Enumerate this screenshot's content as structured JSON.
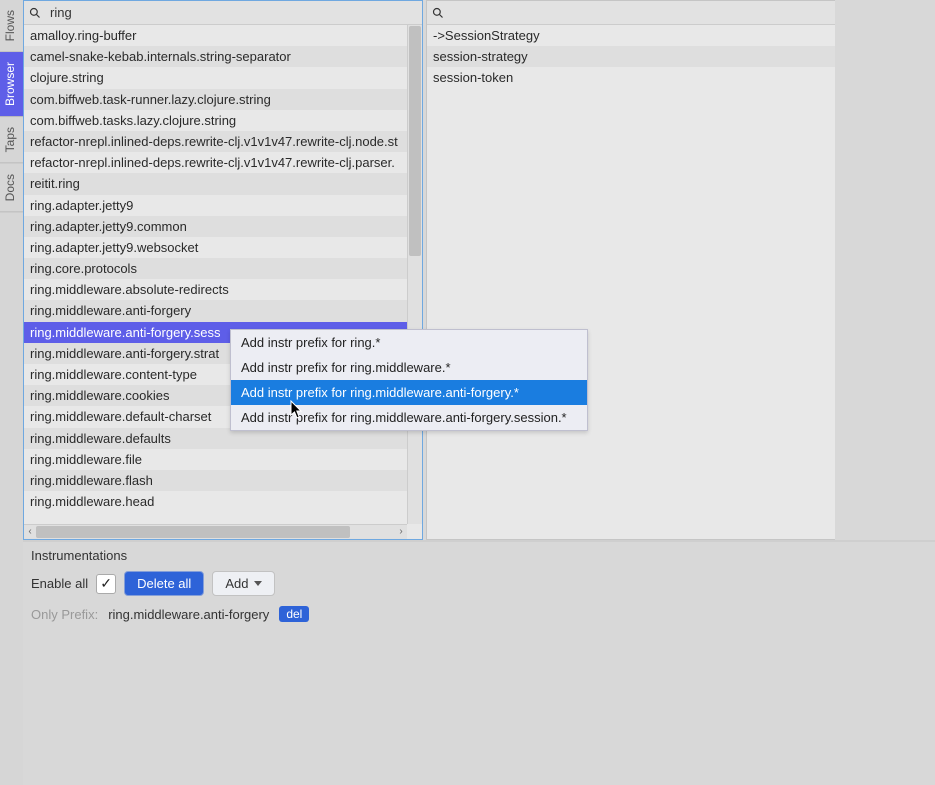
{
  "side_tabs": [
    {
      "id": "flows",
      "label": "Flows",
      "active": false
    },
    {
      "id": "browser",
      "label": "Browser",
      "active": true
    },
    {
      "id": "taps",
      "label": "Taps",
      "active": false
    },
    {
      "id": "docs",
      "label": "Docs",
      "active": false
    }
  ],
  "left_panel": {
    "search_value": "ring",
    "selected_index": 14,
    "items": [
      "amalloy.ring-buffer",
      "camel-snake-kebab.internals.string-separator",
      "clojure.string",
      "com.biffweb.task-runner.lazy.clojure.string",
      "com.biffweb.tasks.lazy.clojure.string",
      "refactor-nrepl.inlined-deps.rewrite-clj.v1v1v47.rewrite-clj.node.st",
      "refactor-nrepl.inlined-deps.rewrite-clj.v1v1v47.rewrite-clj.parser.",
      "reitit.ring",
      "ring.adapter.jetty9",
      "ring.adapter.jetty9.common",
      "ring.adapter.jetty9.websocket",
      "ring.core.protocols",
      "ring.middleware.absolute-redirects",
      "ring.middleware.anti-forgery",
      "ring.middleware.anti-forgery.sess",
      "ring.middleware.anti-forgery.strat",
      "ring.middleware.content-type",
      "ring.middleware.cookies",
      "ring.middleware.default-charset",
      "ring.middleware.defaults",
      "ring.middleware.file",
      "ring.middleware.flash",
      "ring.middleware.head"
    ]
  },
  "right_panel": {
    "search_value": "",
    "items": [
      "->SessionStrategy",
      "session-strategy",
      "session-token"
    ]
  },
  "context_menu": {
    "items": [
      "Add instr prefix for ring.*",
      "Add instr prefix for ring.middleware.*",
      "Add instr prefix for ring.middleware.anti-forgery.*",
      "Add instr prefix for ring.middleware.anti-forgery.session.*"
    ],
    "hover_index": 2
  },
  "instrumentations": {
    "title": "Instrumentations",
    "enable_all_label": "Enable all",
    "enable_all_checked": true,
    "delete_all_label": "Delete all",
    "add_label": "Add",
    "only_prefix_label": "Only Prefix:",
    "prefix_value": "ring.middleware.anti-forgery",
    "del_label": "del"
  }
}
